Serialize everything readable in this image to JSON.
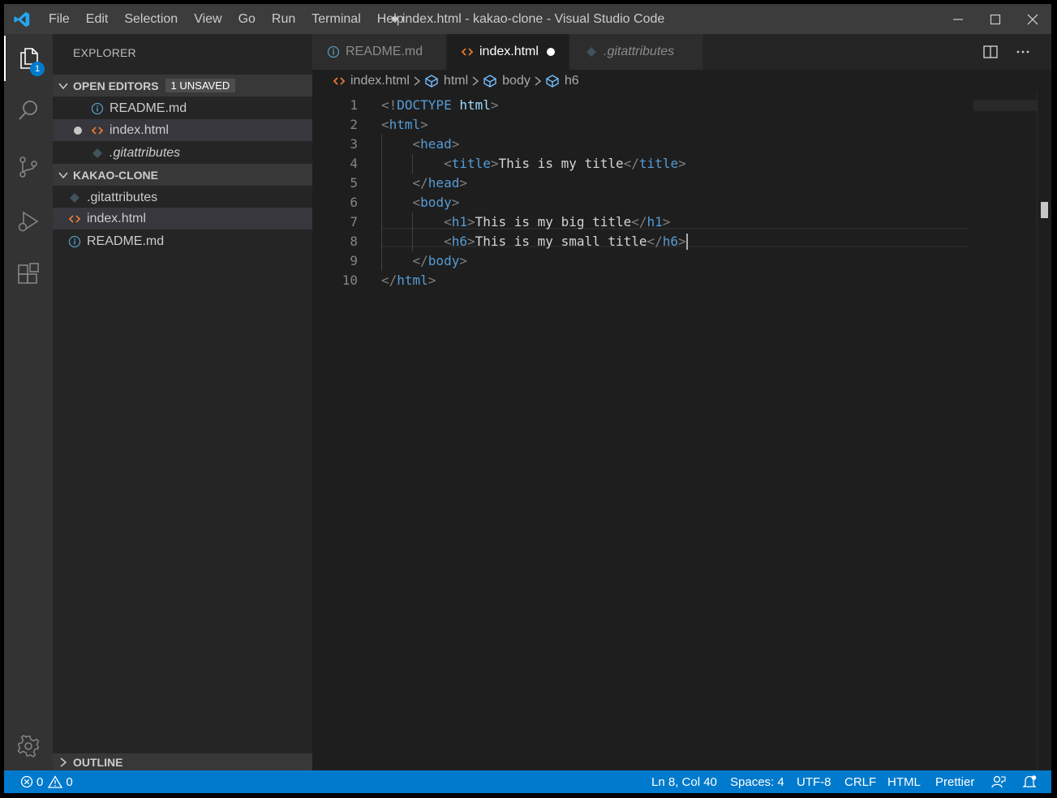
{
  "app": {
    "window_title": "● index.html - kakao-clone - Visual Studio Code",
    "menu": [
      "File",
      "Edit",
      "Selection",
      "View",
      "Go",
      "Run",
      "Terminal",
      "Help"
    ]
  },
  "activity_bar": {
    "explorer_badge": "1"
  },
  "sidebar": {
    "title": "EXPLORER",
    "open_editors": {
      "label": "OPEN EDITORS",
      "badge": "1 UNSAVED",
      "items": [
        {
          "name": "README.md",
          "icon": "info-icon"
        },
        {
          "name": "index.html",
          "icon": "html-icon",
          "unsaved": true
        },
        {
          "name": ".gitattributes",
          "icon": "git-icon"
        }
      ]
    },
    "project": {
      "label": "KAKAO-CLONE",
      "items": [
        {
          "name": ".gitattributes",
          "icon": "git-icon"
        },
        {
          "name": "index.html",
          "icon": "html-icon"
        },
        {
          "name": "README.md",
          "icon": "info-icon"
        }
      ]
    },
    "outline_label": "OUTLINE"
  },
  "tabs": [
    {
      "label": "README.md",
      "icon": "info-icon",
      "active": false
    },
    {
      "label": "index.html",
      "icon": "html-icon",
      "active": true,
      "dirty": true
    },
    {
      "label": ".gitattributes",
      "icon": "git-icon",
      "active": false
    }
  ],
  "breadcrumbs": [
    "index.html",
    "html",
    "body",
    "h6"
  ],
  "editor": {
    "line_numbers": [
      "1",
      "2",
      "3",
      "4",
      "5",
      "6",
      "7",
      "8",
      "9",
      "10"
    ],
    "lines": [
      [
        [
          "br",
          "<!"
        ],
        [
          "tag",
          "DOCTYPE"
        ],
        [
          "txt",
          " "
        ],
        [
          "attr",
          "html"
        ],
        [
          "br",
          ">"
        ]
      ],
      [
        [
          "br",
          "<"
        ],
        [
          "tag",
          "html"
        ],
        [
          "br",
          ">"
        ]
      ],
      [
        [
          "txt",
          "    "
        ],
        [
          "br",
          "<"
        ],
        [
          "tag",
          "head"
        ],
        [
          "br",
          ">"
        ]
      ],
      [
        [
          "txt",
          "        "
        ],
        [
          "br",
          "<"
        ],
        [
          "tag",
          "title"
        ],
        [
          "br",
          ">"
        ],
        [
          "txt",
          "This is my title"
        ],
        [
          "br",
          "</"
        ],
        [
          "tag",
          "title"
        ],
        [
          "br",
          ">"
        ]
      ],
      [
        [
          "txt",
          "    "
        ],
        [
          "br",
          "</"
        ],
        [
          "tag",
          "head"
        ],
        [
          "br",
          ">"
        ]
      ],
      [
        [
          "txt",
          "    "
        ],
        [
          "br",
          "<"
        ],
        [
          "tag",
          "body"
        ],
        [
          "br",
          ">"
        ]
      ],
      [
        [
          "txt",
          "        "
        ],
        [
          "br",
          "<"
        ],
        [
          "tag",
          "h1"
        ],
        [
          "br",
          ">"
        ],
        [
          "txt",
          "This is my big title"
        ],
        [
          "br",
          "</"
        ],
        [
          "tag",
          "h1"
        ],
        [
          "br",
          ">"
        ]
      ],
      [
        [
          "txt",
          "        "
        ],
        [
          "br",
          "<"
        ],
        [
          "tag",
          "h6"
        ],
        [
          "br",
          ">"
        ],
        [
          "txt",
          "This is my small title"
        ],
        [
          "br",
          "</"
        ],
        [
          "tag",
          "h6"
        ],
        [
          "br",
          ">"
        ]
      ],
      [
        [
          "txt",
          "    "
        ],
        [
          "br",
          "</"
        ],
        [
          "tag",
          "body"
        ],
        [
          "br",
          ">"
        ]
      ],
      [
        [
          "br",
          "</"
        ],
        [
          "tag",
          "html"
        ],
        [
          "br",
          ">"
        ]
      ]
    ],
    "colors": {
      "bracket": "#808080",
      "tag": "#569cd6",
      "text": "#d4d4d4",
      "attr": "#9cdcfe"
    }
  },
  "status_bar": {
    "errors": "0",
    "warnings": "0",
    "position": "Ln 8, Col 40",
    "spaces": "Spaces: 4",
    "encoding": "UTF-8",
    "eol": "CRLF",
    "language": "HTML",
    "formatter": "Prettier"
  },
  "colors": {
    "accent": "#007acc",
    "html_icon": "#e37933",
    "info_icon": "#519aba",
    "git_icon": "#41535b"
  }
}
